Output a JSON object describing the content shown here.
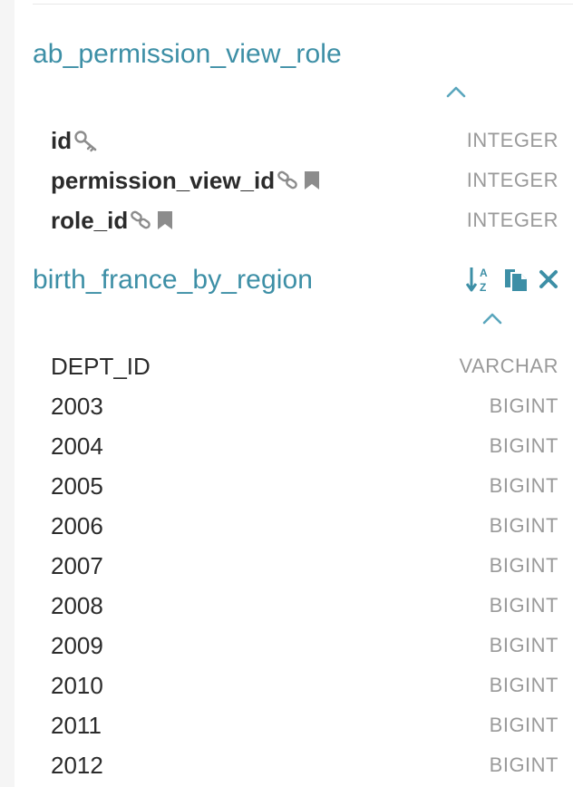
{
  "tables": [
    {
      "name": "ab_permission_view_role",
      "columns": [
        {
          "name": "id",
          "type": "INTEGER",
          "key_icon": "key-icon"
        },
        {
          "name": "permission_view_id",
          "type": "INTEGER",
          "icons": [
            "link-icon",
            "bookmark-icon"
          ]
        },
        {
          "name": "role_id",
          "type": "INTEGER",
          "icons": [
            "link-icon",
            "bookmark-icon"
          ]
        }
      ]
    },
    {
      "name": "birth_france_by_region",
      "actions": [
        "sort-alpha-icon",
        "copy-icon",
        "close-icon"
      ],
      "columns": [
        {
          "name": "DEPT_ID",
          "type": "VARCHAR"
        },
        {
          "name": "2003",
          "type": "BIGINT"
        },
        {
          "name": "2004",
          "type": "BIGINT"
        },
        {
          "name": "2005",
          "type": "BIGINT"
        },
        {
          "name": "2006",
          "type": "BIGINT"
        },
        {
          "name": "2007",
          "type": "BIGINT"
        },
        {
          "name": "2008",
          "type": "BIGINT"
        },
        {
          "name": "2009",
          "type": "BIGINT"
        },
        {
          "name": "2010",
          "type": "BIGINT"
        },
        {
          "name": "2011",
          "type": "BIGINT"
        },
        {
          "name": "2012",
          "type": "BIGINT"
        }
      ]
    }
  ],
  "colors": {
    "title": "#3d8fa6",
    "accent": "#5aa6bd",
    "column_name": "#2b2b2b",
    "column_type": "#9a9a9a",
    "icon_gray": "#8c8c8c"
  }
}
